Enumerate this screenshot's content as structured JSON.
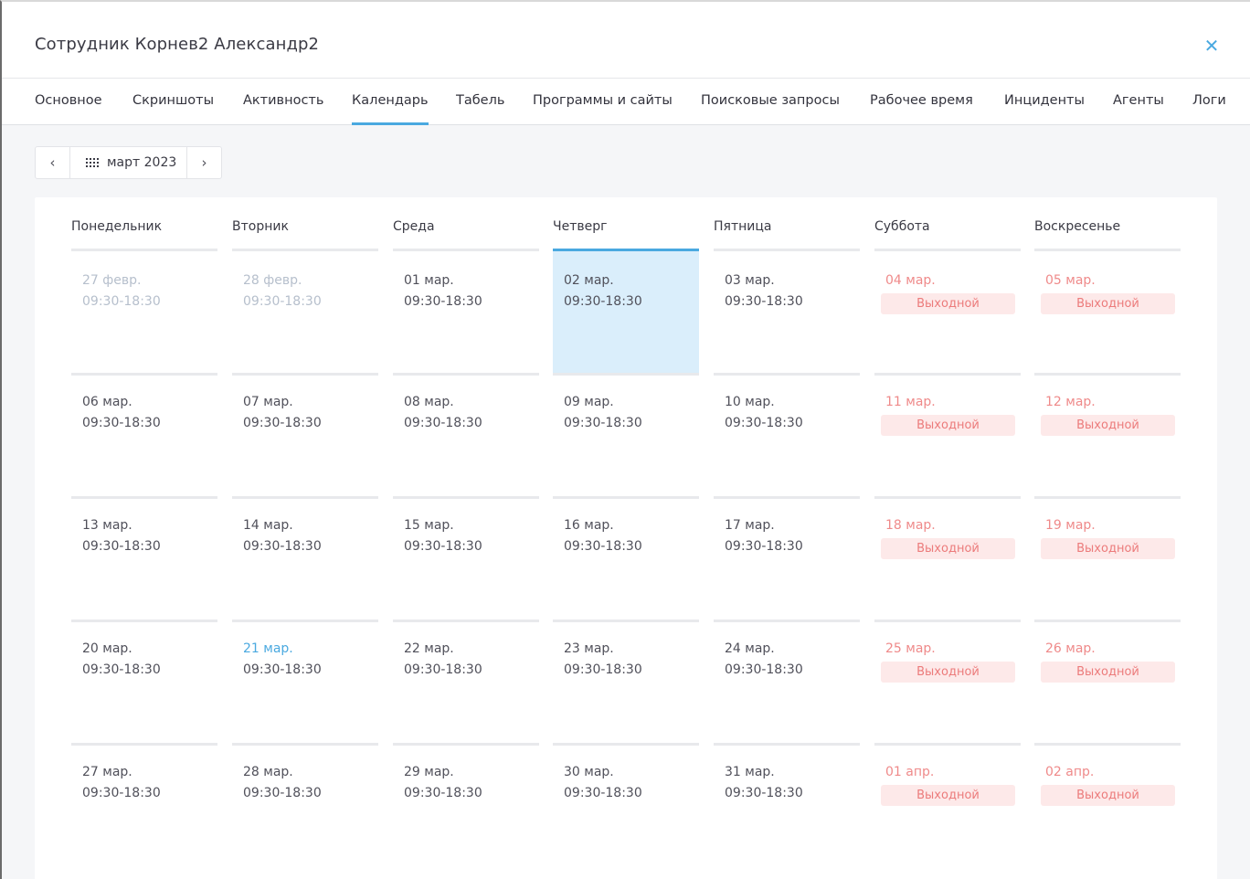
{
  "modal": {
    "title": "Сотрудник Корнев2 Александр2",
    "close_icon": "close-icon",
    "colors": {
      "accent": "#4aa9e0",
      "weekend": "#ef8a8a",
      "dayoff_bg": "#fde9e9",
      "today_bg": "#daeefb"
    }
  },
  "tabs": [
    {
      "label": "Основное"
    },
    {
      "label": "Скриншоты"
    },
    {
      "label": "Активность"
    },
    {
      "label": "Календарь",
      "active": true
    },
    {
      "label": "Табель"
    },
    {
      "label": "Программы и сайты"
    },
    {
      "label": "Поисковые запросы"
    },
    {
      "label": "Рабочее время"
    },
    {
      "label": "Инциденты"
    },
    {
      "label": "Агенты"
    },
    {
      "label": "Логи"
    }
  ],
  "month_nav": {
    "prev_icon": "chevron-left-icon",
    "prev_glyph": "‹",
    "next_icon": "chevron-right-icon",
    "next_glyph": "›",
    "picker_icon": "grid-icon",
    "month_label": "март 2023"
  },
  "calendar": {
    "weekdays": [
      "Понедельник",
      "Вторник",
      "Среда",
      "Четверг",
      "Пятница",
      "Суббота",
      "Воскресенье"
    ],
    "dayoff_label": "Выходной",
    "weeks": [
      [
        {
          "date": "27 февр.",
          "hours": "09:30-18:30",
          "state": "faded"
        },
        {
          "date": "28 февр.",
          "hours": "09:30-18:30",
          "state": "faded"
        },
        {
          "date": "01 мар.",
          "hours": "09:30-18:30",
          "state": "normal"
        },
        {
          "date": "02 мар.",
          "hours": "09:30-18:30",
          "state": "today"
        },
        {
          "date": "03 мар.",
          "hours": "09:30-18:30",
          "state": "normal"
        },
        {
          "date": "04 мар.",
          "state": "weekend"
        },
        {
          "date": "05 мар.",
          "state": "weekend"
        }
      ],
      [
        {
          "date": "06 мар.",
          "hours": "09:30-18:30",
          "state": "normal"
        },
        {
          "date": "07 мар.",
          "hours": "09:30-18:30",
          "state": "normal"
        },
        {
          "date": "08 мар.",
          "hours": "09:30-18:30",
          "state": "normal"
        },
        {
          "date": "09 мар.",
          "hours": "09:30-18:30",
          "state": "normal"
        },
        {
          "date": "10 мар.",
          "hours": "09:30-18:30",
          "state": "normal"
        },
        {
          "date": "11 мар.",
          "state": "weekend"
        },
        {
          "date": "12 мар.",
          "state": "weekend"
        }
      ],
      [
        {
          "date": "13 мар.",
          "hours": "09:30-18:30",
          "state": "normal"
        },
        {
          "date": "14 мар.",
          "hours": "09:30-18:30",
          "state": "normal"
        },
        {
          "date": "15 мар.",
          "hours": "09:30-18:30",
          "state": "normal"
        },
        {
          "date": "16 мар.",
          "hours": "09:30-18:30",
          "state": "normal"
        },
        {
          "date": "17 мар.",
          "hours": "09:30-18:30",
          "state": "normal"
        },
        {
          "date": "18 мар.",
          "state": "weekend"
        },
        {
          "date": "19 мар.",
          "state": "weekend"
        }
      ],
      [
        {
          "date": "20 мар.",
          "hours": "09:30-18:30",
          "state": "normal"
        },
        {
          "date": "21 мар.",
          "hours": "09:30-18:30",
          "state": "highlight"
        },
        {
          "date": "22 мар.",
          "hours": "09:30-18:30",
          "state": "normal"
        },
        {
          "date": "23 мар.",
          "hours": "09:30-18:30",
          "state": "normal"
        },
        {
          "date": "24 мар.",
          "hours": "09:30-18:30",
          "state": "normal"
        },
        {
          "date": "25 мар.",
          "state": "weekend"
        },
        {
          "date": "26 мар.",
          "state": "weekend"
        }
      ],
      [
        {
          "date": "27 мар.",
          "hours": "09:30-18:30",
          "state": "normal"
        },
        {
          "date": "28 мар.",
          "hours": "09:30-18:30",
          "state": "normal"
        },
        {
          "date": "29 мар.",
          "hours": "09:30-18:30",
          "state": "normal"
        },
        {
          "date": "30 мар.",
          "hours": "09:30-18:30",
          "state": "normal"
        },
        {
          "date": "31 мар.",
          "hours": "09:30-18:30",
          "state": "normal"
        },
        {
          "date": "01 апр.",
          "state": "weekend"
        },
        {
          "date": "02 апр.",
          "state": "weekend"
        }
      ]
    ]
  }
}
